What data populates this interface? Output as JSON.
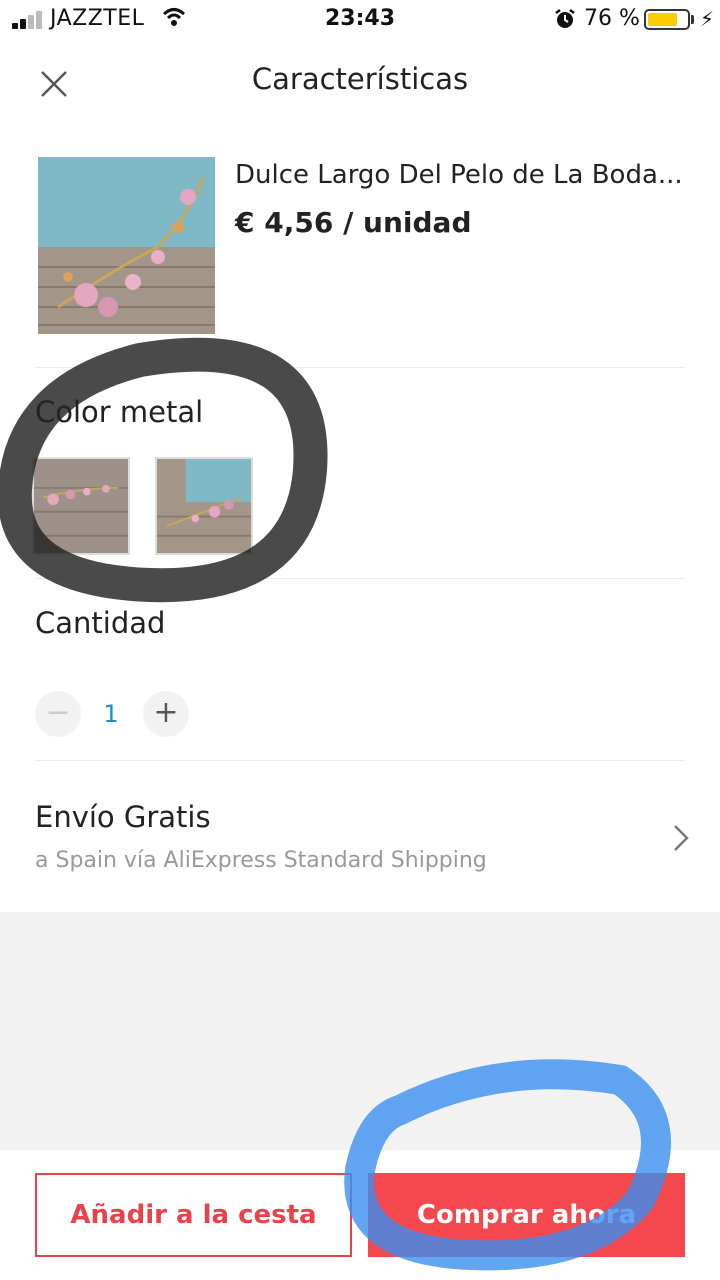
{
  "status_bar": {
    "carrier": "JAZZTEL",
    "time": "23:43",
    "battery_percent": "76 %",
    "battery_level": 0.76,
    "icons": [
      "signal-icon",
      "wifi-icon",
      "alarm-icon",
      "battery-icon",
      "charging-icon"
    ]
  },
  "header": {
    "title": "Características",
    "close_icon": "close-icon"
  },
  "product": {
    "name": "Dulce Largo Del Pelo de La Boda...",
    "price": "€ 4,56 / unidad"
  },
  "color_section": {
    "label": "Color metal",
    "options": [
      "swatch-1",
      "swatch-2"
    ]
  },
  "quantity_section": {
    "label": "Cantidad",
    "value": "1",
    "minus_icon": "minus-icon",
    "plus_icon": "plus-icon"
  },
  "shipping": {
    "title": "Envío Gratis",
    "subtitle": "a Spain vía AliExpress Standard Shipping",
    "chevron_icon": "chevron-right-icon"
  },
  "actions": {
    "add_to_cart": "Añadir a la cesta",
    "buy_now": "Comprar ahora"
  },
  "colors": {
    "accent": "#f5474e",
    "accent_outline": "#e8424a",
    "quantity_value": "#1a8ccc",
    "annotation_dark": "#222222",
    "annotation_blue": "#3b8ef0"
  }
}
